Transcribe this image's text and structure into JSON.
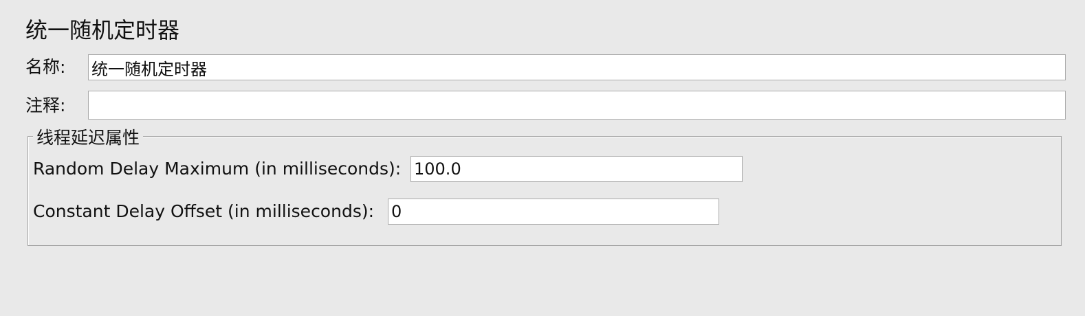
{
  "title": "统一随机定时器",
  "name_field": {
    "label": "名称:",
    "value": "统一随机定时器"
  },
  "comment_field": {
    "label": "注释:",
    "value": ""
  },
  "thread_delay": {
    "legend": "线程延迟属性",
    "random_delay_max": {
      "label": "Random Delay Maximum (in milliseconds):",
      "value": "100.0"
    },
    "constant_delay_offset": {
      "label": "Constant Delay Offset (in milliseconds):",
      "value": "0"
    }
  }
}
